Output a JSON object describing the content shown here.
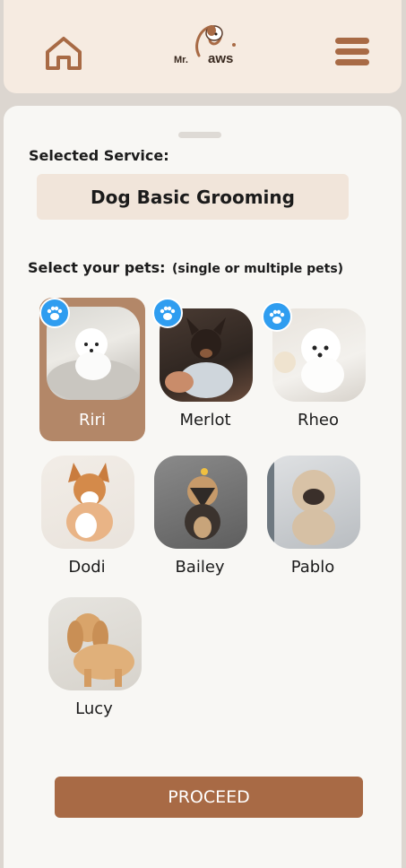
{
  "header": {
    "logo_text_left": "Mr.",
    "logo_text_right": "aws"
  },
  "service": {
    "label": "Selected Service:",
    "value": "Dog Basic Grooming"
  },
  "pets": {
    "label": "Select your  pets:",
    "hint": "(single or multiple pets)",
    "items": [
      {
        "name": "Riri",
        "selected": true,
        "has_paw": true
      },
      {
        "name": "Merlot",
        "selected": false,
        "has_paw": true
      },
      {
        "name": "Rheo",
        "selected": false,
        "has_paw": true
      },
      {
        "name": "Dodi",
        "selected": false,
        "has_paw": false
      },
      {
        "name": "Bailey",
        "selected": false,
        "has_paw": false
      },
      {
        "name": "Pablo",
        "selected": false,
        "has_paw": false
      },
      {
        "name": "Lucy",
        "selected": false,
        "has_paw": false
      }
    ]
  },
  "proceed_label": "PROCEED",
  "colors": {
    "brand": "#a86a45",
    "selected_card": "#b38768",
    "paw_badge": "#2f9df0",
    "header_bg": "#f6ebe1"
  }
}
